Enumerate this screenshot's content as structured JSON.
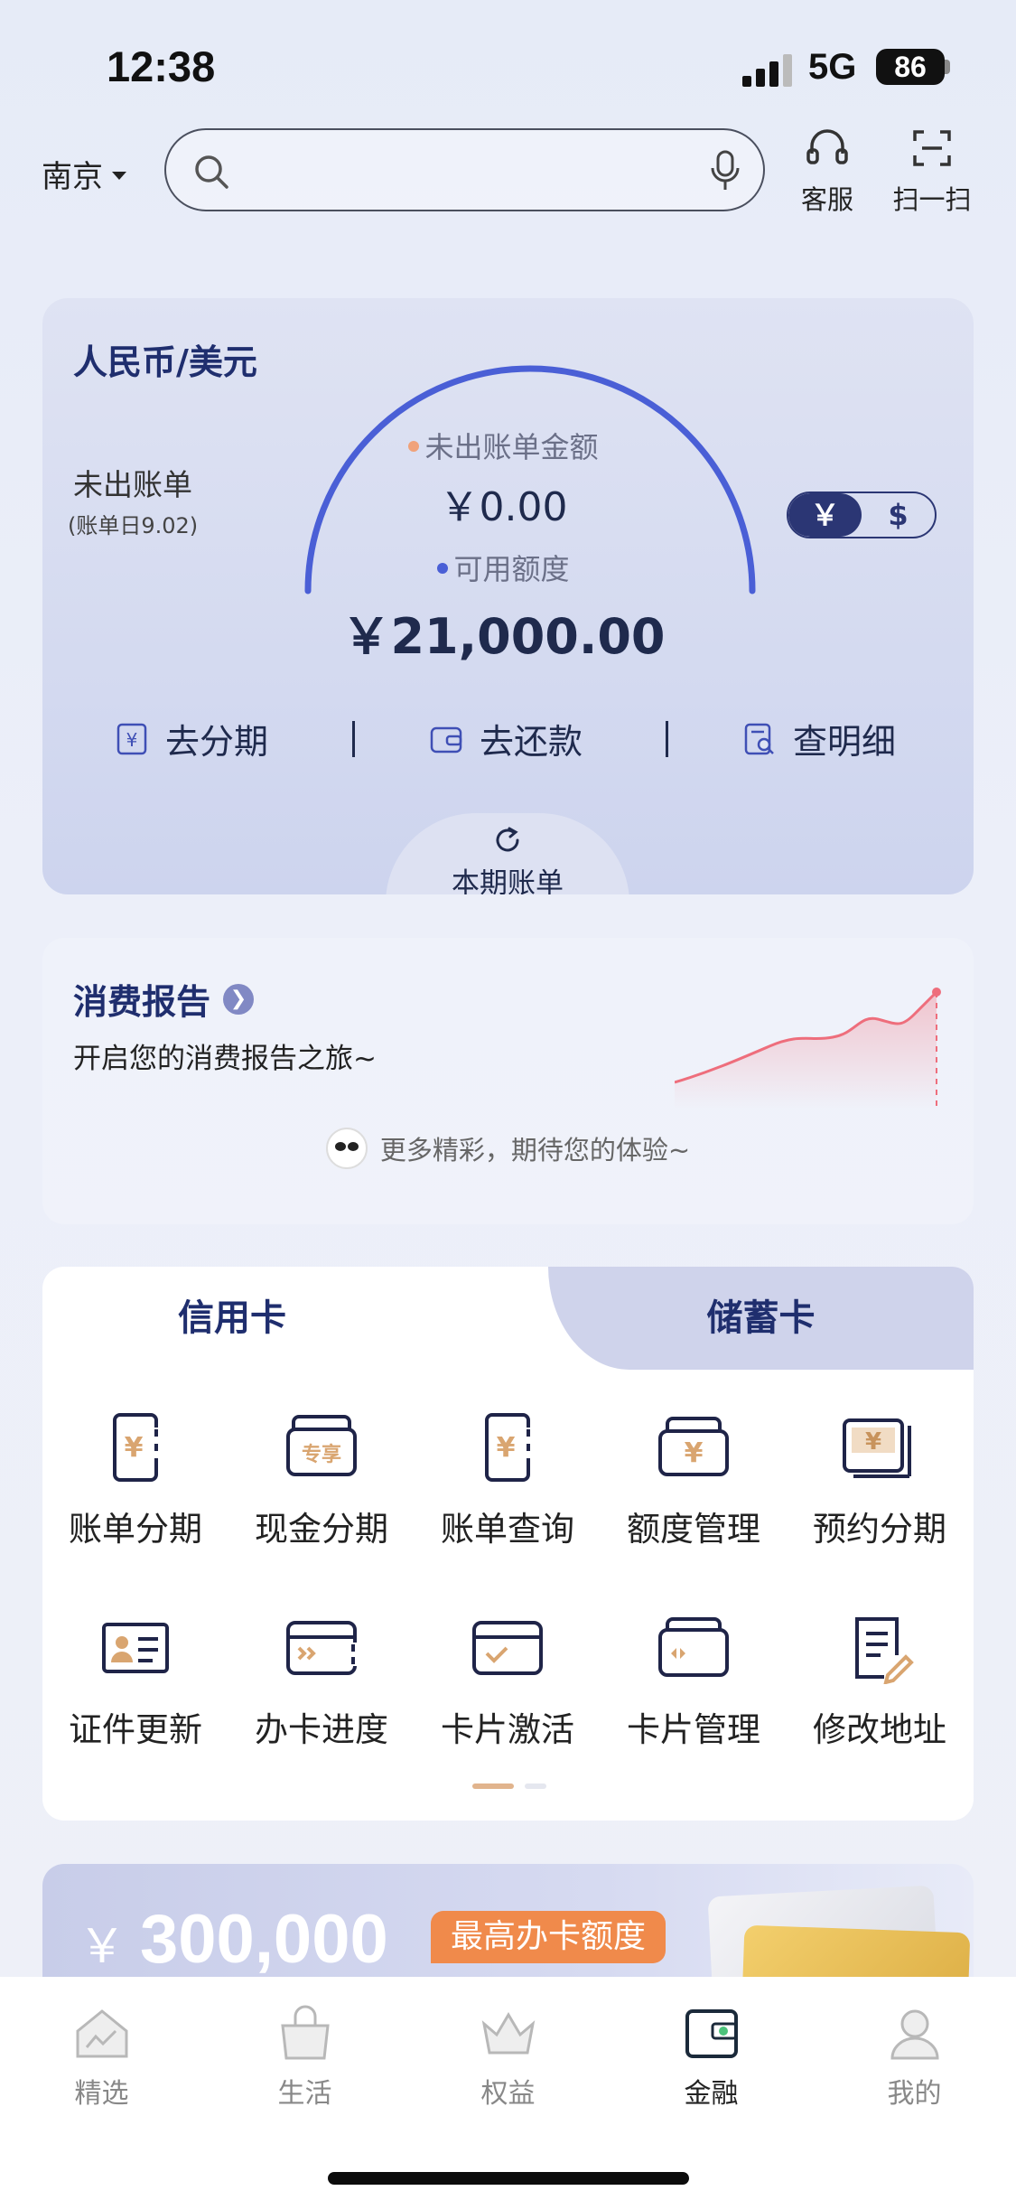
{
  "status": {
    "time": "12:38",
    "network": "5G",
    "battery": "86"
  },
  "topbar": {
    "city": "南京",
    "search_placeholder": "",
    "service_label": "客服",
    "scan_label": "扫一扫"
  },
  "bill": {
    "currency_title": "人民币/美元",
    "unbilled_label": "未出账单",
    "bill_day": "(账单日9.02)",
    "unbilled_amount_label": "未出账单金额",
    "unbilled_amount": "￥0.00",
    "available_label": "可用额度",
    "available_amount": "￥21,000.00",
    "toggle_cny": "￥",
    "toggle_usd": "$",
    "actions": [
      "去分期",
      "去还款",
      "查明细"
    ],
    "current_bill_tab": "本期账单",
    "colors": {
      "arc": "#4a5fd6",
      "dot_unbilled": "#f0a27a",
      "dot_available": "#4a5fd6"
    }
  },
  "report": {
    "title": "消费报告",
    "subtitle": "开启您的消费报告之旅~",
    "more_text": "更多精彩，期待您的体验~"
  },
  "cards": {
    "tab_credit": "信用卡",
    "tab_debit": "储蓄卡",
    "items": [
      {
        "label": "账单分期",
        "icon": "bill-installment-icon"
      },
      {
        "label": "现金分期",
        "icon": "cash-installment-icon"
      },
      {
        "label": "账单查询",
        "icon": "bill-query-icon"
      },
      {
        "label": "额度管理",
        "icon": "limit-management-icon"
      },
      {
        "label": "预约分期",
        "icon": "reserve-installment-icon"
      },
      {
        "label": "证件更新",
        "icon": "id-update-icon"
      },
      {
        "label": "办卡进度",
        "icon": "application-progress-icon"
      },
      {
        "label": "卡片激活",
        "icon": "card-activation-icon"
      },
      {
        "label": "卡片管理",
        "icon": "card-management-icon"
      },
      {
        "label": "修改地址",
        "icon": "edit-address-icon"
      }
    ],
    "icon_texts": {
      "exclusive": "专享",
      "yen": "¥"
    }
  },
  "promo": {
    "yen": "￥",
    "amount": "300,000",
    "badge": "最高办卡额度"
  },
  "nav": [
    {
      "label": "精选",
      "icon": "featured-icon",
      "active": false
    },
    {
      "label": "生活",
      "icon": "life-icon",
      "active": false
    },
    {
      "label": "权益",
      "icon": "benefits-icon",
      "active": false
    },
    {
      "label": "金融",
      "icon": "finance-icon",
      "active": true
    },
    {
      "label": "我的",
      "icon": "profile-icon",
      "active": false
    }
  ]
}
